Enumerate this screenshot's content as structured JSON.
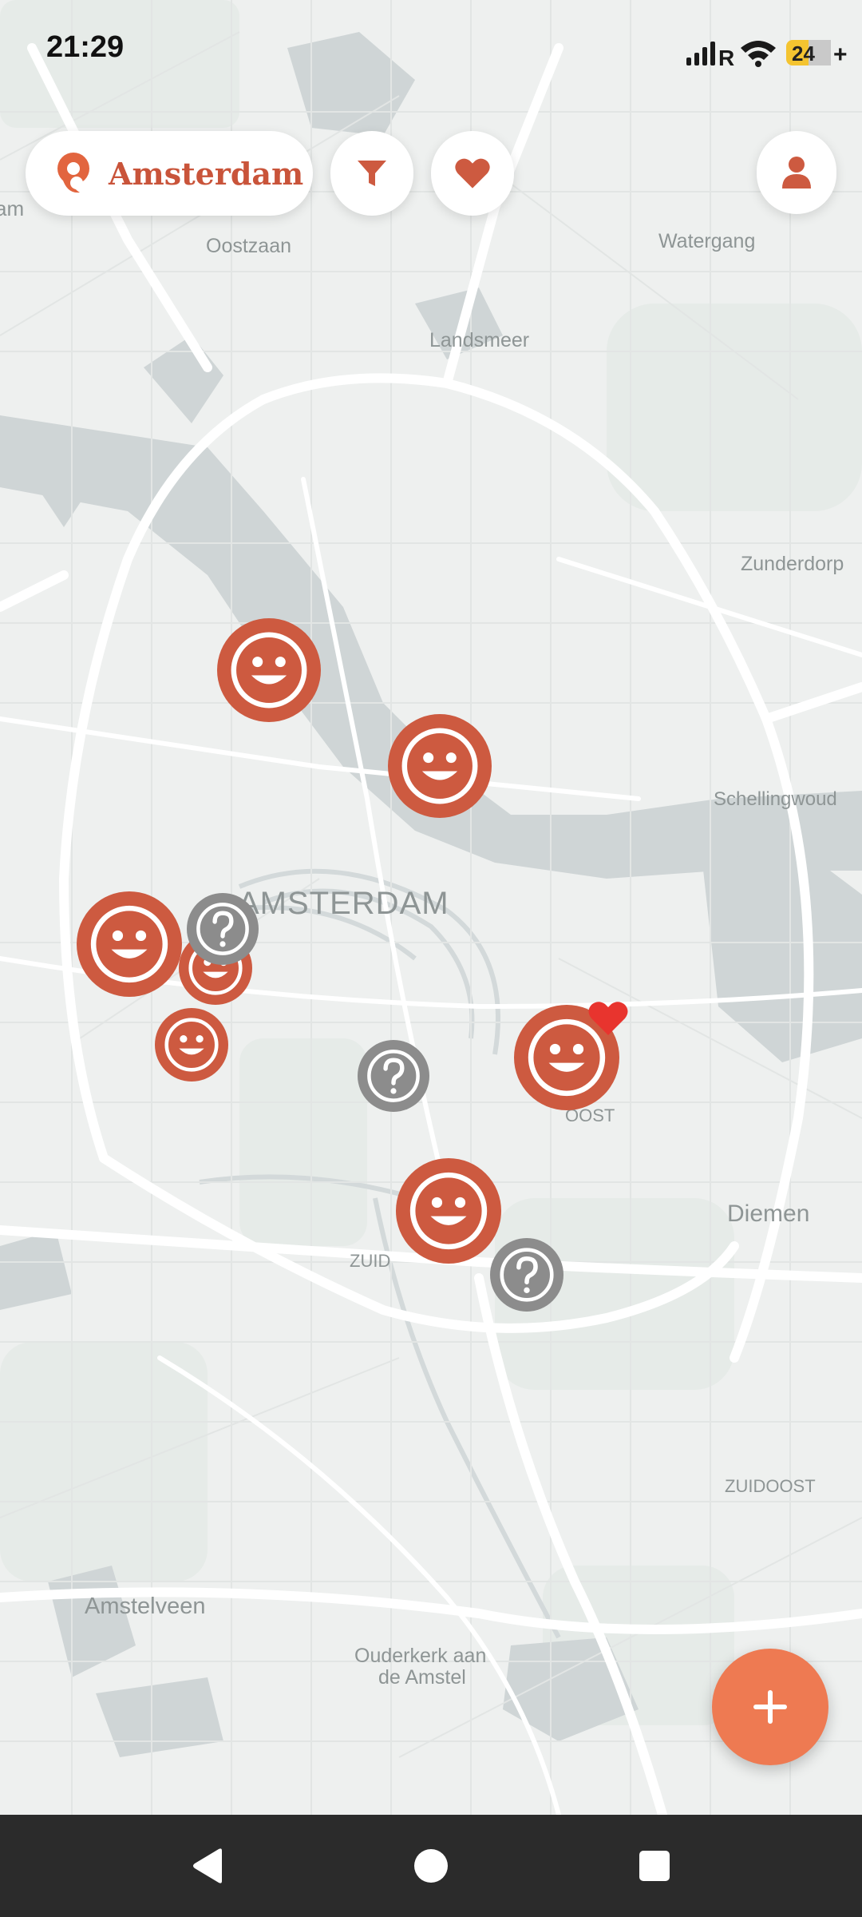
{
  "status_bar": {
    "time": "21:29",
    "network_label": "R",
    "battery_level": "24",
    "battery_suffix": "+",
    "icons": [
      "signal-icon",
      "wifi-icon",
      "battery-icon"
    ]
  },
  "header": {
    "city_name": "Amsterdam",
    "buttons": [
      "location-logo-icon",
      "filter-icon",
      "heart-icon",
      "user-icon"
    ]
  },
  "map": {
    "labels": {
      "edge_left": "am",
      "oostzaan": "Oostzaan",
      "watergang": "Watergang",
      "landsmeer": "Landsmeer",
      "zunderdorp": "Zunderdorp",
      "schellingwoude": "Schellingwoud",
      "amsterdam": "AMSTERDAM",
      "oost": "OOST",
      "diemen": "Diemen",
      "zuid": "ZUID",
      "zuidoost": "ZUIDOOST",
      "amstelveen": "Amstelveen",
      "ouderkerk_line1": "Ouderkerk aan",
      "ouderkerk_line2": "de Amstel"
    },
    "markers": [
      {
        "type": "happy",
        "favorite": false
      },
      {
        "type": "happy",
        "favorite": false
      },
      {
        "type": "happy",
        "favorite": false
      },
      {
        "type": "happy",
        "favorite": false
      },
      {
        "type": "unknown",
        "favorite": false
      },
      {
        "type": "happy",
        "favorite": false
      },
      {
        "type": "unknown",
        "favorite": false
      },
      {
        "type": "happy",
        "favorite": true
      },
      {
        "type": "happy",
        "favorite": false
      },
      {
        "type": "unknown",
        "favorite": false
      }
    ]
  },
  "fab": {
    "icon": "plus-icon"
  },
  "nav": {
    "icons": [
      "back-icon",
      "home-icon",
      "recents-icon"
    ]
  },
  "colors": {
    "accent": "#cd5a40",
    "fab": "#ee7a52",
    "unknown_marker": "#8c8c8c",
    "favorite": "#e8342e",
    "map_background": "#eef0ef",
    "water": "#cfd5d6"
  }
}
